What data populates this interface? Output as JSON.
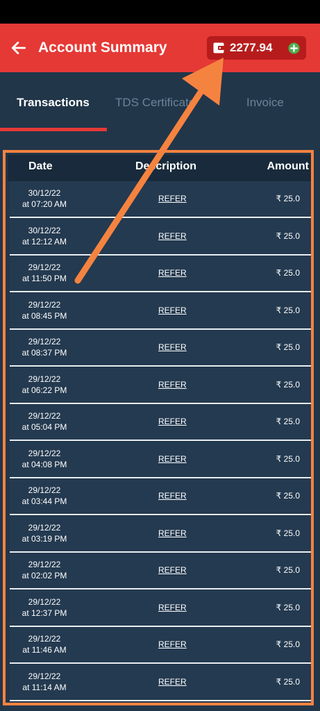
{
  "header": {
    "title": "Account Summary",
    "wallet_balance": "2277.94"
  },
  "tabs": [
    {
      "label": "Transactions"
    },
    {
      "label": "TDS Certificate"
    },
    {
      "label": "Invoice"
    }
  ],
  "table": {
    "columns": [
      "Date",
      "Description",
      "Amount"
    ],
    "rows": [
      {
        "date": "30/12/22",
        "time": "at 07:20 AM",
        "description": "REFER",
        "amount": "₹ 25.0"
      },
      {
        "date": "30/12/22",
        "time": "at 12:12 AM",
        "description": "REFER",
        "amount": "₹ 25.0"
      },
      {
        "date": "29/12/22",
        "time": "at 11:50 PM",
        "description": "REFER",
        "amount": "₹ 25.0"
      },
      {
        "date": "29/12/22",
        "time": "at 08:45 PM",
        "description": "REFER",
        "amount": "₹ 25.0"
      },
      {
        "date": "29/12/22",
        "time": "at 08:37 PM",
        "description": "REFER",
        "amount": "₹ 25.0"
      },
      {
        "date": "29/12/22",
        "time": "at 06:22 PM",
        "description": "REFER",
        "amount": "₹ 25.0"
      },
      {
        "date": "29/12/22",
        "time": "at 05:04 PM",
        "description": "REFER",
        "amount": "₹ 25.0"
      },
      {
        "date": "29/12/22",
        "time": "at 04:08 PM",
        "description": "REFER",
        "amount": "₹ 25.0"
      },
      {
        "date": "29/12/22",
        "time": "at 03:44 PM",
        "description": "REFER",
        "amount": "₹ 25.0"
      },
      {
        "date": "29/12/22",
        "time": "at 03:19 PM",
        "description": "REFER",
        "amount": "₹ 25.0"
      },
      {
        "date": "29/12/22",
        "time": "at 02:02 PM",
        "description": "REFER",
        "amount": "₹ 25.0"
      },
      {
        "date": "29/12/22",
        "time": "at 12:37 PM",
        "description": "REFER",
        "amount": "₹ 25.0"
      },
      {
        "date": "29/12/22",
        "time": "at 11:46 AM",
        "description": "REFER",
        "amount": "₹ 25.0"
      },
      {
        "date": "29/12/22",
        "time": "at 11:14 AM",
        "description": "REFER",
        "amount": "₹ 25.0"
      }
    ]
  },
  "colors": {
    "header": "#e53935",
    "background": "#22364a",
    "annotation": "#f58340"
  },
  "icons": {
    "back": "arrow-left-icon",
    "wallet": "wallet-icon",
    "add": "plus-circle-icon"
  }
}
